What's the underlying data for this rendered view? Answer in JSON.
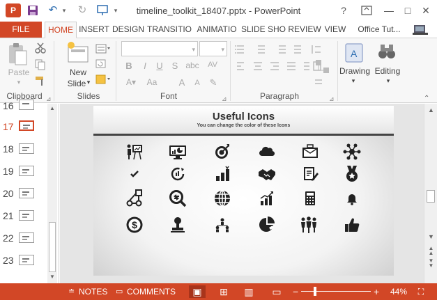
{
  "window": {
    "title": "timeline_toolkit_18407.pptx - PowerPoint",
    "help": "?",
    "minimize": "—",
    "restore": "□",
    "close": "✕"
  },
  "tabs": [
    {
      "label": "FILE"
    },
    {
      "label": "HOME"
    },
    {
      "label": "INSERT"
    },
    {
      "label": "DESIGN"
    },
    {
      "label": "TRANSITIO"
    },
    {
      "label": "ANIMATIO"
    },
    {
      "label": "SLIDE SHO"
    },
    {
      "label": "REVIEW"
    },
    {
      "label": "VIEW"
    },
    {
      "label": "Office Tut..."
    }
  ],
  "ribbon": {
    "paste": "Paste",
    "new_slide_1": "New",
    "new_slide_2": "Slide",
    "drawing": "Drawing",
    "editing": "Editing",
    "groups": {
      "clipboard": "Clipboard",
      "slides": "Slides",
      "font": "Font",
      "paragraph": "Paragraph"
    }
  },
  "thumbnails": [
    {
      "num": "16"
    },
    {
      "num": "17"
    },
    {
      "num": "18"
    },
    {
      "num": "19"
    },
    {
      "num": "20"
    },
    {
      "num": "21"
    },
    {
      "num": "22"
    },
    {
      "num": "23"
    }
  ],
  "slide": {
    "title": "Useful Icons",
    "subtitle": "You can change the color of these Icons"
  },
  "icons": [
    [
      "presentation-icon",
      "monitor-chart-icon",
      "target-icon",
      "cloud-icon",
      "briefcase-icon",
      "network-icon"
    ],
    [
      "checkmark-icon",
      "cycle-icon",
      "bar-chart-icon",
      "handshake-icon",
      "document-edit-icon",
      "medal-icon"
    ],
    [
      "flowchart-icon",
      "magnifier-icon",
      "globe-icon",
      "growth-chart-icon",
      "calculator-icon",
      "bell-icon"
    ],
    [
      "dollar-coin-icon",
      "stamp-icon",
      "org-chart-icon",
      "pie-chart-icon",
      "team-icon",
      "thumbs-up-icon"
    ]
  ],
  "status": {
    "notes": "NOTES",
    "comments": "COMMENTS",
    "zoom": "44%",
    "minus": "−",
    "plus": "+"
  },
  "colors": {
    "accent": "#d24726",
    "dark_accent": "#a8341b"
  }
}
